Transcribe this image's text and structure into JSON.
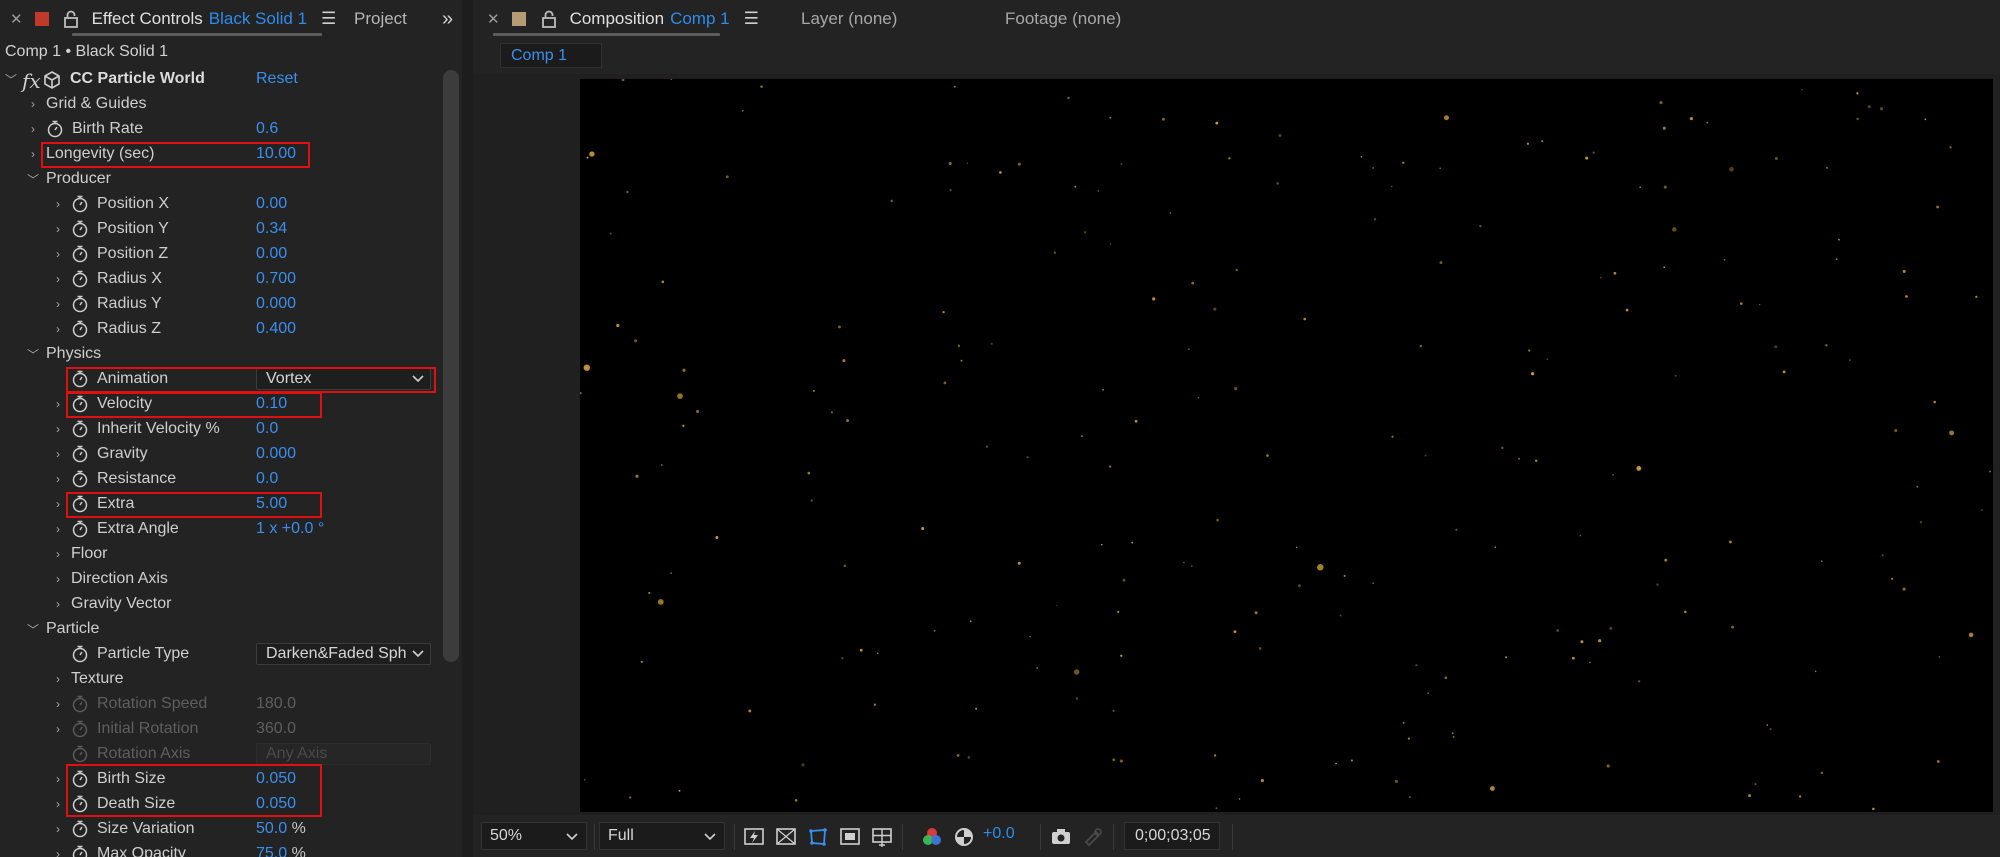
{
  "effect_controls_panel": {
    "tab": {
      "title": "Effect Controls",
      "layer": "Black Solid 1"
    },
    "project_tab": "Project",
    "expand_glyph": "»",
    "header": "Comp 1 • Black Solid 1",
    "effect": {
      "fx": "fx",
      "name": "CC Particle World",
      "reset": "Reset"
    },
    "properties": {
      "grid_guides": "Grid & Guides",
      "birth_rate": {
        "label": "Birth Rate",
        "value": "0.6"
      },
      "longevity": {
        "label": "Longevity (sec)",
        "value": "10.00"
      },
      "producer": "Producer",
      "position_x": {
        "label": "Position X",
        "value": "0.00"
      },
      "position_y": {
        "label": "Position Y",
        "value": "0.34"
      },
      "position_z": {
        "label": "Position Z",
        "value": "0.00"
      },
      "radius_x": {
        "label": "Radius X",
        "value": "0.700"
      },
      "radius_y": {
        "label": "Radius Y",
        "value": "0.000"
      },
      "radius_z": {
        "label": "Radius Z",
        "value": "0.400"
      },
      "physics": "Physics",
      "animation": {
        "label": "Animation",
        "value": "Vortex"
      },
      "velocity": {
        "label": "Velocity",
        "value": "0.10"
      },
      "inherit_velocity": {
        "label": "Inherit Velocity %",
        "value": "0.0"
      },
      "gravity": {
        "label": "Gravity",
        "value": "0.000"
      },
      "resistance": {
        "label": "Resistance",
        "value": "0.0"
      },
      "extra": {
        "label": "Extra",
        "value": "5.00"
      },
      "extra_angle": {
        "label": "Extra Angle",
        "value": "1 x +0.0 °"
      },
      "floor": "Floor",
      "direction_axis": "Direction Axis",
      "gravity_vector": "Gravity Vector",
      "particle": "Particle",
      "particle_type": {
        "label": "Particle Type",
        "value": "Darken&Faded Sph"
      },
      "texture": "Texture",
      "rotation_speed": {
        "label": "Rotation Speed",
        "value": "180.0"
      },
      "initial_rotation": {
        "label": "Initial Rotation",
        "value": "360.0"
      },
      "rotation_axis": {
        "label": "Rotation Axis",
        "value": "Any Axis"
      },
      "birth_size": {
        "label": "Birth Size",
        "value": "0.050"
      },
      "death_size": {
        "label": "Death Size",
        "value": "0.050"
      },
      "size_variation": {
        "label": "Size Variation",
        "value": "50.0",
        "unit": "%"
      },
      "max_opacity": {
        "label": "Max Opacity",
        "value": "75.0",
        "unit": "%"
      }
    }
  },
  "composition_panel": {
    "tab": {
      "title": "Composition",
      "comp": "Comp 1"
    },
    "layer_tab": "Layer (none)",
    "footage_tab": "Footage (none)",
    "comp_subtab": "Comp 1",
    "viewer_footer": {
      "zoom": "50%",
      "resolution": "Full",
      "exposure": "+0.0",
      "timecode": "0;00;03;05"
    }
  },
  "colors": {
    "accent_blue": "#2d8ceb",
    "highlight_red": "#e01010",
    "particle_gold": "#d7a43c",
    "panel_bg": "#232323",
    "canvas_bg": "#000000"
  }
}
